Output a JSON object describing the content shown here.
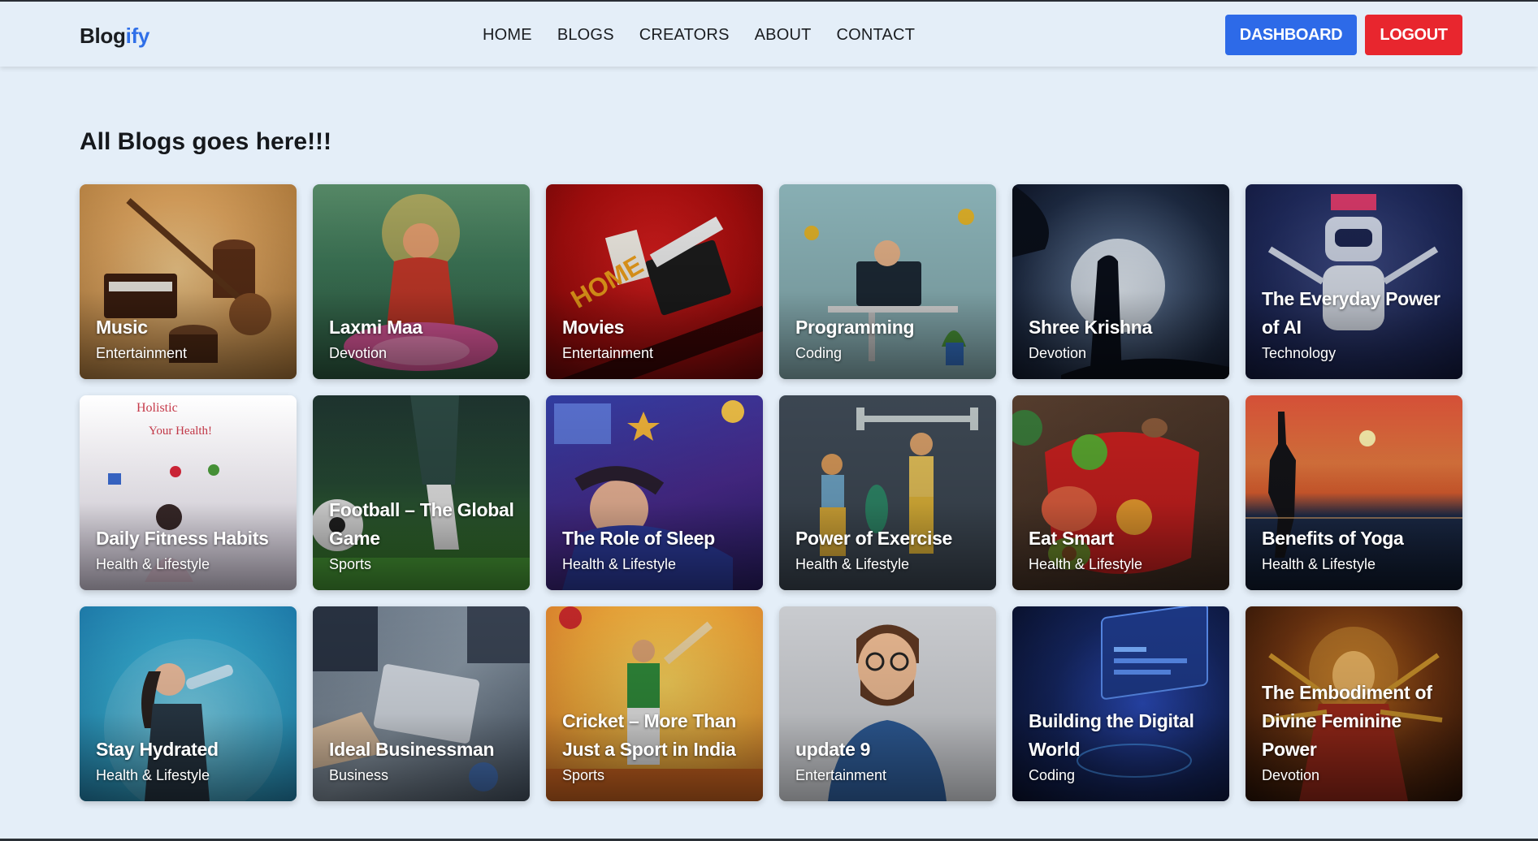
{
  "brand": {
    "name_part1": "Blog",
    "name_part2": "ify"
  },
  "nav": {
    "links": [
      "HOME",
      "BLOGS",
      "CREATORS",
      "ABOUT",
      "CONTACT"
    ]
  },
  "actions": {
    "dashboard": "DASHBOARD",
    "logout": "LOGOUT"
  },
  "main": {
    "title": "All Blogs goes here!!!"
  },
  "colors": {
    "background": "#e4eef8",
    "accent": "#2d6ae8",
    "danger": "#e8262e"
  },
  "blogs": [
    {
      "title": "Music",
      "category": "Entertainment"
    },
    {
      "title": "Laxmi Maa",
      "category": "Devotion"
    },
    {
      "title": "Movies",
      "category": "Entertainment"
    },
    {
      "title": "Programming",
      "category": "Coding"
    },
    {
      "title": "Shree Krishna",
      "category": "Devotion"
    },
    {
      "title": "The Everyday Power of AI",
      "category": "Technology"
    },
    {
      "title": "Daily Fitness Habits",
      "category": "Health & Lifestyle"
    },
    {
      "title": "Football – The Global Game",
      "category": "Sports"
    },
    {
      "title": "The Role of Sleep",
      "category": "Health & Lifestyle"
    },
    {
      "title": "Power of Exercise",
      "category": "Health & Lifestyle"
    },
    {
      "title": "Eat Smart",
      "category": "Health & Lifestyle"
    },
    {
      "title": "Benefits of Yoga",
      "category": "Health & Lifestyle"
    },
    {
      "title": "Stay Hydrated",
      "category": "Health & Lifestyle"
    },
    {
      "title": "Ideal Businessman",
      "category": "Business"
    },
    {
      "title": "Cricket – More Than Just a Sport in India",
      "category": "Sports"
    },
    {
      "title": "update 9",
      "category": "Entertainment"
    },
    {
      "title": "Building the Digital World",
      "category": "Coding"
    },
    {
      "title": "The Embodiment of Divine Feminine Power",
      "category": "Devotion"
    }
  ]
}
